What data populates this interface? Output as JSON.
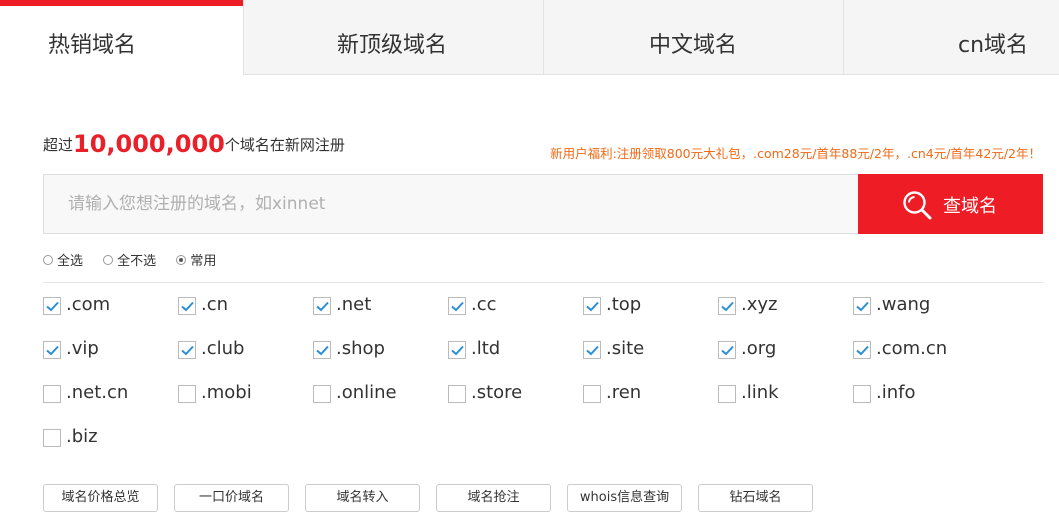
{
  "tabs": [
    {
      "label": "热销域名",
      "active": true
    },
    {
      "label": "新顶级域名",
      "active": false
    },
    {
      "label": "中文域名",
      "active": false
    },
    {
      "label": "cn域名",
      "active": false
    }
  ],
  "headline": {
    "prefix": "超过",
    "count": "10,000,000",
    "suffix": "个域名在新网注册"
  },
  "promo": "新用户福利:注册领取800元大礼包，.com28元/首年88元/2年，.cn4元/首年42元/2年！",
  "search": {
    "placeholder": "请输入您想注册的域名，如xinnet",
    "value": "",
    "button_label": "查域名"
  },
  "select_options": [
    {
      "label": "全选",
      "selected": false
    },
    {
      "label": "全不选",
      "selected": false
    },
    {
      "label": "常用",
      "selected": true
    }
  ],
  "tlds": [
    {
      "name": ".com",
      "checked": true
    },
    {
      "name": ".cn",
      "checked": true
    },
    {
      "name": ".net",
      "checked": true
    },
    {
      "name": ".cc",
      "checked": true
    },
    {
      "name": ".top",
      "checked": true
    },
    {
      "name": ".xyz",
      "checked": true
    },
    {
      "name": ".wang",
      "checked": true
    },
    {
      "name": ".vip",
      "checked": true
    },
    {
      "name": ".club",
      "checked": true
    },
    {
      "name": ".shop",
      "checked": true
    },
    {
      "name": ".ltd",
      "checked": true
    },
    {
      "name": ".site",
      "checked": true
    },
    {
      "name": ".org",
      "checked": true
    },
    {
      "name": ".com.cn",
      "checked": true
    },
    {
      "name": ".net.cn",
      "checked": false
    },
    {
      "name": ".mobi",
      "checked": false
    },
    {
      "name": ".online",
      "checked": false
    },
    {
      "name": ".store",
      "checked": false
    },
    {
      "name": ".ren",
      "checked": false
    },
    {
      "name": ".link",
      "checked": false
    },
    {
      "name": ".info",
      "checked": false
    },
    {
      "name": ".biz",
      "checked": false
    }
  ],
  "quick_links": [
    "域名价格总览",
    "一口价域名",
    "域名转入",
    "域名抢注",
    "whois信息查询",
    "钻石域名"
  ],
  "colors": {
    "accent": "#ee1c25",
    "promo": "#f06a17",
    "check": "#2a8fd6"
  }
}
